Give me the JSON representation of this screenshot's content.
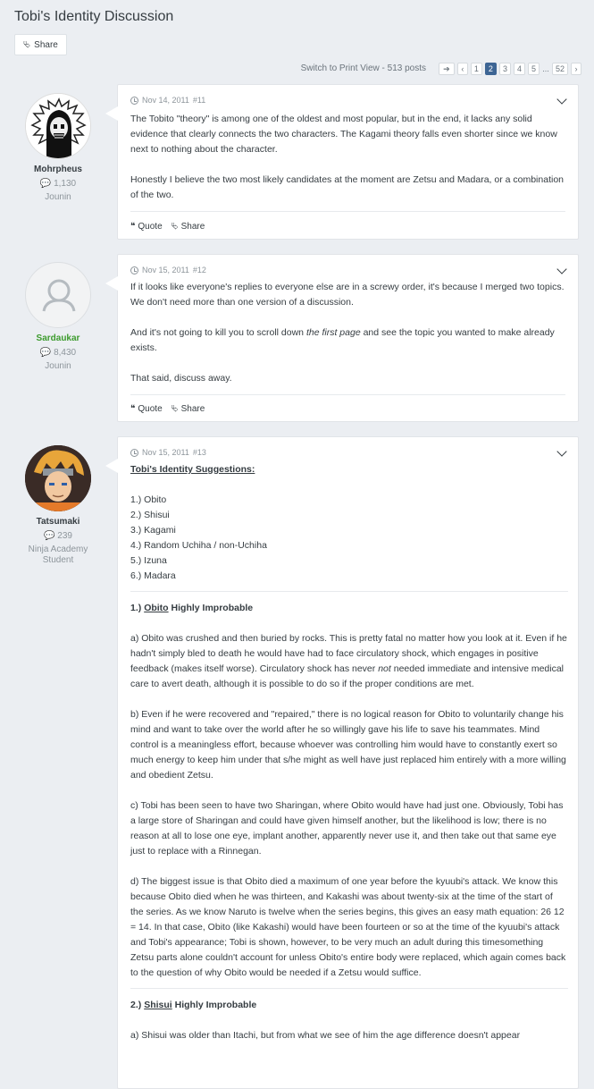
{
  "topic": {
    "title": "Tobi's Identity Discussion",
    "share_label": "Share"
  },
  "pagination": {
    "print_view": "Switch to Print View - 513 posts",
    "pages": [
      "1",
      "2",
      "3",
      "4",
      "5",
      "...",
      "52"
    ],
    "current": "2"
  },
  "posts": [
    {
      "author": {
        "name": "Mohrpheus",
        "post_count": "1,130",
        "rank": "Jounin"
      },
      "date": "Nov 14, 2011",
      "number": "#11",
      "paragraphs": [
        "The Tobito \"theory\" is among one of the oldest and most popular, but in the end, it lacks any solid evidence that clearly connects the two characters. The Kagami theory falls even shorter since we know next to nothing about the character.",
        "Honestly I believe the two most likely candidates at the moment are Zetsu and Madara, or a combination of the two."
      ],
      "quote_label": "Quote",
      "share_label": "Share"
    },
    {
      "author": {
        "name": "Sardaukar",
        "post_count": "8,430",
        "rank": "Jounin"
      },
      "date": "Nov 15, 2011",
      "number": "#12",
      "p1": "If it looks like everyone's replies to everyone else are in a screwy order, it's because I merged two topics. We don't need more than one version of a discussion.",
      "p2_before": "And it's not going to kill you to scroll down ",
      "p2_italic": "the first page",
      "p2_after": " and see the topic you wanted to make already exists.",
      "p3": "That said, discuss away.",
      "quote_label": "Quote",
      "share_label": "Share"
    },
    {
      "author": {
        "name": "Tatsumaki",
        "post_count": "239",
        "rank_line1": "Ninja Academy",
        "rank_line2": "Student"
      },
      "date": "Nov 15, 2011",
      "number": "#13",
      "heading": "Tobi's Identity Suggestions:",
      "list": [
        "1.) Obito",
        "2.) Shisui",
        "3.) Kagami",
        "4.) Random Uchiha / non-Uchiha",
        "5.) Izuna",
        "6.) Madara"
      ],
      "obito": {
        "num": "1.)",
        "name": "Obito",
        "verdict": " Highly Improbable",
        "a_before": "a) Obito was crushed and then buried by rocks. This is pretty fatal no matter how you look at it. Even if he hadn't simply bled to death he would have had to face circulatory shock, which engages in positive feedback (makes itself worse). Circulatory shock has never ",
        "a_italic": "not",
        "a_after": " needed immediate and intensive medical care to avert death, although it is possible to do so if the proper conditions are met.",
        "b": "b) Even if he were recovered and \"repaired,\" there is no logical reason for Obito to voluntarily change his mind and want to take over the world after he so willingly gave his life to save his teammates. Mind control is a meaningless effort, because whoever was controlling him would have to constantly exert so much energy to keep him under that s/he might as well have just replaced him entirely with a more willing and obedient Zetsu.",
        "c": "c) Tobi has been seen to have two Sharingan, where Obito would have had just one. Obviously, Tobi has a large store of Sharingan and could have given himself another, but the likelihood is low; there is no reason at all to lose one eye, implant another, apparently never use it, and then take out that same eye just to replace with a Rinnegan.",
        "d": "d) The biggest issue is that Obito died a maximum of one year before the kyuubi's attack. We know this because Obito died when he was thirteen, and Kakashi was about twenty-six at the time of the start of the series. As we know Naruto is twelve when the series begins, this gives an easy math equation: 26  12 = 14. In that case, Obito (like Kakashi) would have been fourteen or so at the time of the kyuubi's attack and Tobi's appearance; Tobi is shown, however, to be very much an adult during this timesomething Zetsu parts alone couldn't account for unless Obito's entire body were replaced, which again comes back to the question of why Obito would be needed if a Zetsu would suffice."
      },
      "shisui": {
        "num": "2.)",
        "name": "Shisui",
        "verdict": " Highly Improbable",
        "a": "a) Shisui was older than Itachi, but from what we see of him the age difference doesn't appear"
      }
    }
  ],
  "colors": {
    "background": "#ebeef2",
    "accent": "#3d6594",
    "green_name": "#3c9b2d"
  }
}
